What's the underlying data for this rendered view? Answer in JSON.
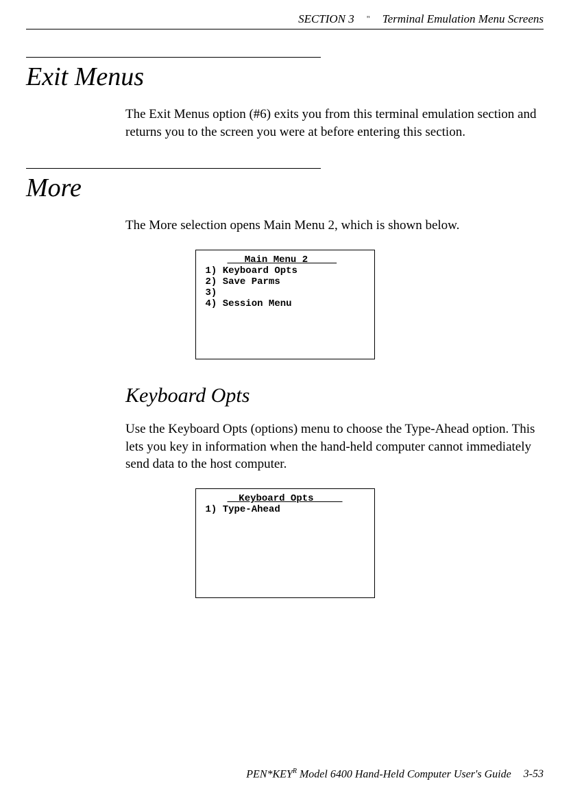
{
  "header": {
    "section": "SECTION 3",
    "bullet": "\"",
    "title": "Terminal Emulation Menu Screens"
  },
  "section1": {
    "heading": "Exit Menus",
    "body": "The Exit Menus option (#6) exits you from this terminal emulation section and returns you to the screen you were at before entering this section."
  },
  "section2": {
    "heading": "More",
    "body": "The More selection opens Main Menu 2, which is shown below."
  },
  "screen1": {
    "title": "   Main Menu 2     ",
    "lines": [
      "1) Keyboard Opts",
      "2) Save Parms",
      "3)",
      "4) Session Menu"
    ]
  },
  "subsection": {
    "heading": "Keyboard Opts",
    "body": "Use the Keyboard Opts (options) menu to choose the Type-Ahead option.  This lets you key in information when the hand-held computer cannot immediately send data to the host computer."
  },
  "screen2": {
    "title": "  Keyboard Opts     ",
    "lines": [
      "1) Type-Ahead"
    ]
  },
  "footer": {
    "brand_pre": "PEN*KEY",
    "brand_sup": "R",
    "guide": " Model 6400 Hand-Held Computer User's Guide",
    "pageno": "3-53"
  }
}
